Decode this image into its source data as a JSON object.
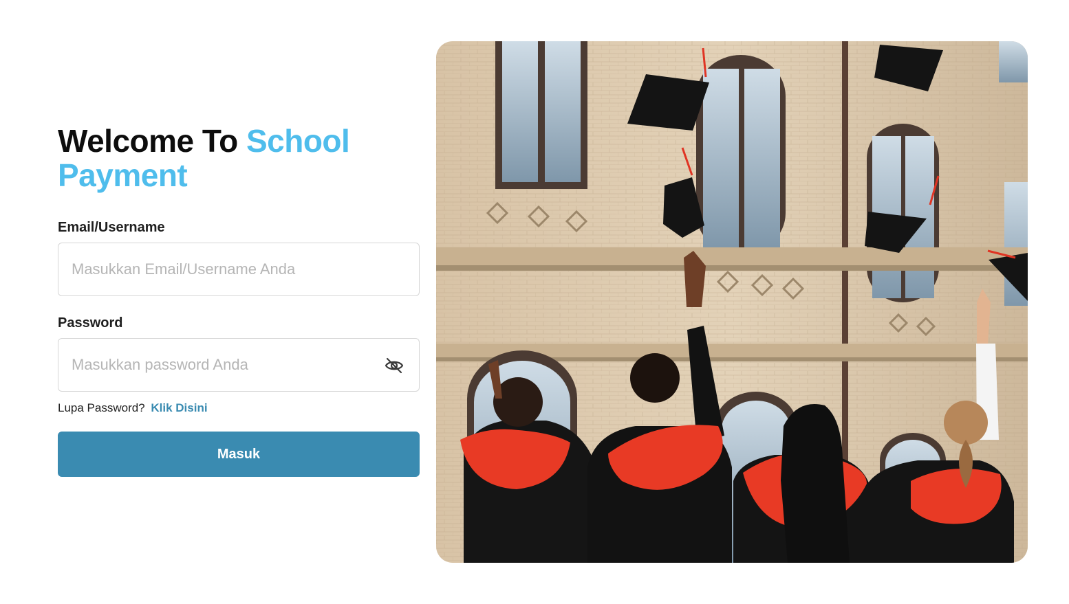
{
  "login": {
    "title_prefix": "Welcome To ",
    "title_accent": "School Payment",
    "email_label": "Email/Username",
    "email_placeholder": "Masukkan Email/Username Anda",
    "email_value": "",
    "password_label": "Password",
    "password_placeholder": "Masukkan password Anda",
    "password_value": "",
    "password_toggle_icon": "eye-off-icon",
    "forgot_text": "Lupa Password?",
    "forgot_link": "Klik Disini",
    "submit_label": "Masuk"
  },
  "colors": {
    "accent": "#4fbdec",
    "primary_button": "#3a8bb1",
    "link": "#3a8bb1",
    "title": "#0d0d0d"
  }
}
